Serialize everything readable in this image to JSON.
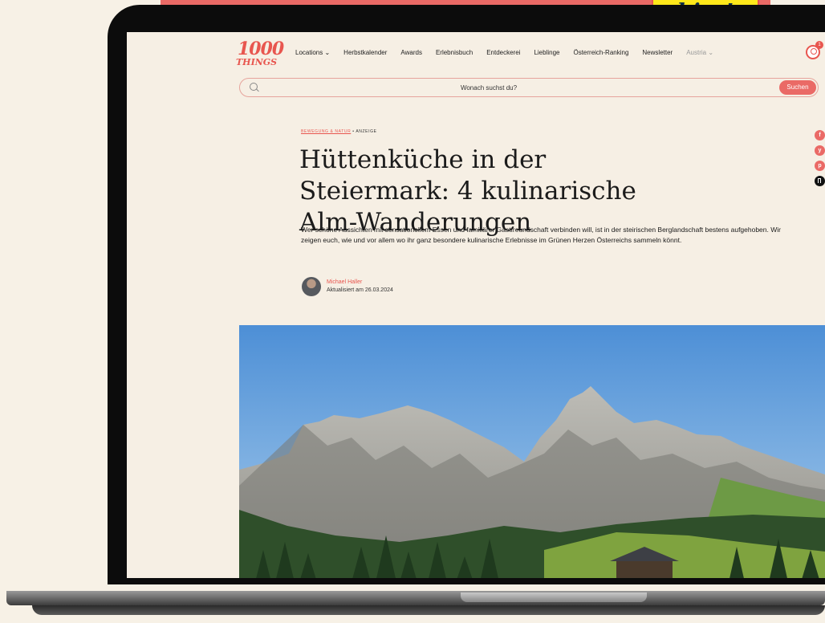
{
  "promo": {
    "label": "hier!"
  },
  "header": {
    "logo_line1": "1000",
    "logo_line2": "THINGS",
    "nav": [
      "Locations ⌄",
      "Herbstkalender",
      "Awards",
      "Erlebnisbuch",
      "Entdeckerei",
      "Lieblinge",
      "Österreich-Ranking",
      "Newsletter"
    ],
    "country": "Austria ⌄",
    "notification_count": "1"
  },
  "search": {
    "placeholder": "Wonach suchst du?",
    "button": "Suchen"
  },
  "article": {
    "category": "BEWEGUNG & NATUR",
    "tag": "• ANZEIGE",
    "title": "Hüttenküche in der Steiermark: 4 kulinarische Alm-Wanderungen",
    "lead": "Wer schöne Aussichten mit sensationellem Essen und familiärer Gastfreundschaft verbinden will, ist in der steirischen Berglandschaft bestens aufgehoben. Wir zeigen euch, wie und vor allem wo ihr ganz besondere kulinarische Erlebnisse im Grünen Herzen Österreichs sammeln könnt.",
    "author": "Michael Haller",
    "date": "Aktualisiert am 26.03.2024"
  },
  "share": {
    "facebook": "f",
    "twitter": "y",
    "pinterest": "p"
  },
  "colors": {
    "accent": "#ea6a66",
    "background": "#f6efe4",
    "promo": "#ffe81a"
  }
}
